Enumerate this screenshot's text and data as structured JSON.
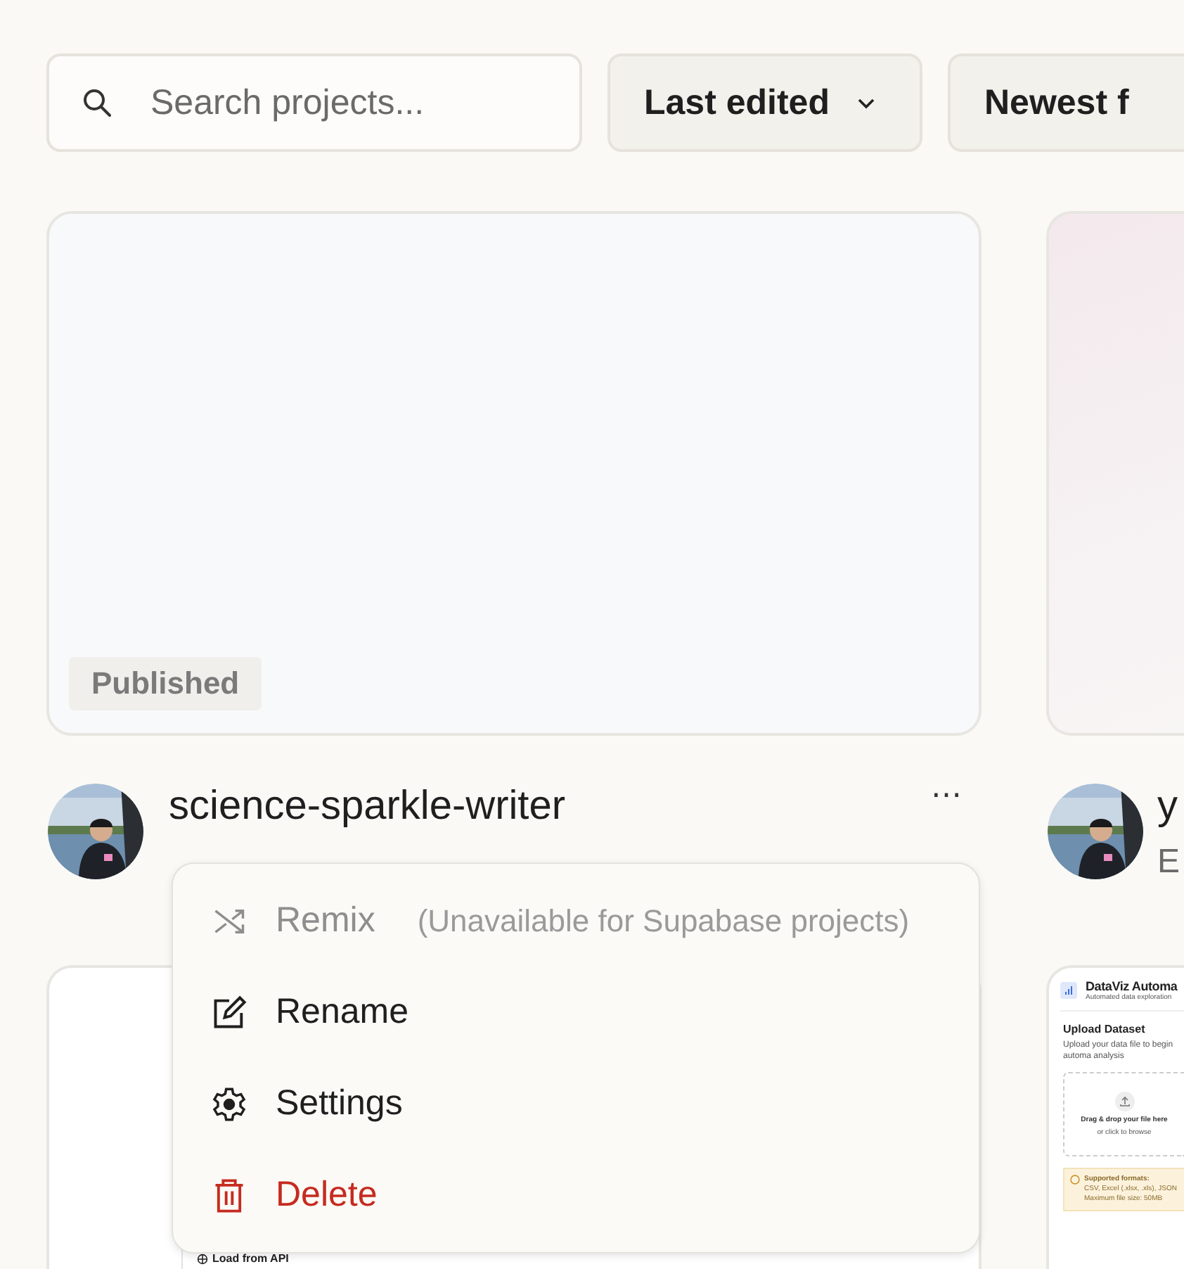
{
  "search": {
    "placeholder": "Search projects..."
  },
  "sort_buttons": [
    {
      "label": "Last edited",
      "dropdown": true
    },
    {
      "label": "Newest f",
      "dropdown": false
    }
  ],
  "projects": [
    {
      "title": "science-sparkle-writer",
      "badge": "Published",
      "more": "⋯",
      "thumbnail": {
        "kind": "blank"
      }
    },
    {
      "title": "y",
      "subtitle": "E",
      "thumbnail": {
        "kind": "gradient"
      }
    },
    {
      "thumbnail": {
        "kind": "api",
        "caption": "Load from API"
      }
    },
    {
      "thumbnail": {
        "kind": "dataviz",
        "app_title": "DataViz Automa",
        "app_subtitle": "Automated data exploration",
        "heading": "Upload Dataset",
        "text": "Upload your data file to begin automa analysis",
        "drop_title": "Drag & drop your file here",
        "drop_hint": "or click to browse",
        "note_title": "Supported formats:",
        "note_lines": [
          "CSV, Excel (.xlsx, .xls), JSON",
          "Maximum file size: 50MB"
        ]
      }
    }
  ],
  "context_menu": {
    "items": [
      {
        "kind": "remix",
        "label": "Remix",
        "note": "(Unavailable for Supabase projects)",
        "disabled": true,
        "danger": false
      },
      {
        "kind": "rename",
        "label": "Rename",
        "disabled": false,
        "danger": false
      },
      {
        "kind": "settings",
        "label": "Settings",
        "disabled": false,
        "danger": false
      },
      {
        "kind": "delete",
        "label": "Delete",
        "disabled": false,
        "danger": true
      }
    ]
  }
}
